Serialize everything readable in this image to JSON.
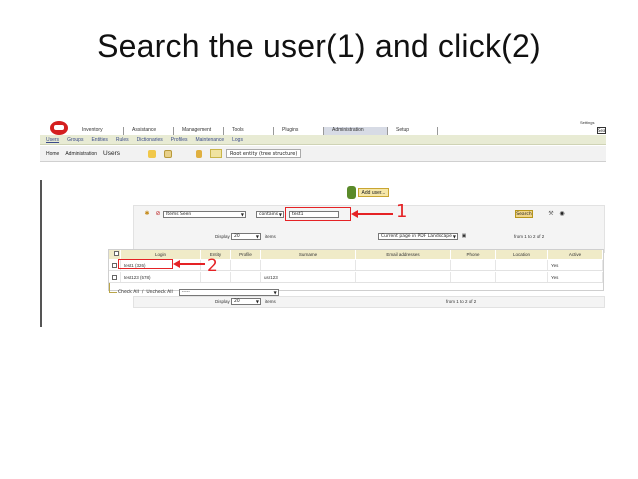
{
  "slide": {
    "title": "Search the user(1) and click(2)"
  },
  "header": {
    "menu": [
      "Inventory",
      "Assistance",
      "Management",
      "Tools",
      "Plugins",
      "Administration",
      "Setup"
    ],
    "active_menu": "Administration",
    "top_right": "Settings",
    "top_search_value": "Sea"
  },
  "subnav": {
    "items": [
      "Users",
      "Groups",
      "Entities",
      "Rules",
      "Dictionaries",
      "Profiles",
      "Maintenance",
      "Logs"
    ]
  },
  "breadcrumb": {
    "home": "Home",
    "section": "Administration",
    "page": "Users",
    "entity": "Root entity (tree structure)"
  },
  "add_user": {
    "label": "Add user..."
  },
  "search": {
    "field": "Items Seen",
    "operator": "contains",
    "value": "test1",
    "button": "Search"
  },
  "pager_top": {
    "display_label": "Display",
    "display_value": "20",
    "items_label": "items",
    "export_value": "Current page in PDF Landscape",
    "range": "from 1 to 2 of 2"
  },
  "table": {
    "columns": [
      "Login",
      "Entity",
      "Profile",
      "Surname",
      "Email addresses",
      "Phone",
      "Location",
      "Active"
    ],
    "rows": [
      {
        "login": "test1 (326)",
        "surname": "",
        "active": "Yes"
      },
      {
        "login": "test123 (578)",
        "surname": "usr123",
        "active": "Yes"
      }
    ]
  },
  "actions": {
    "check_all": "Check All",
    "separator": "/",
    "uncheck_all": "Uncheck All",
    "action_value": "-----"
  },
  "pager_bottom": {
    "display_label": "Display",
    "display_value": "20",
    "items_label": "items",
    "range": "from 1 to 2 of 2"
  },
  "annotations": {
    "step1": "1",
    "step2": "2"
  },
  "colors": {
    "annotation": "#e52225",
    "subnav_bg": "#e8ebd4",
    "header_row": "#f0ebc8",
    "search_button": "#f0d58a"
  }
}
